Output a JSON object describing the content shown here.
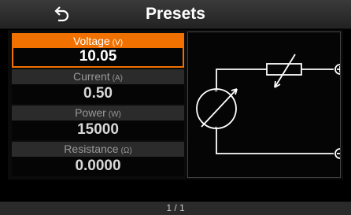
{
  "header": {
    "title": "Presets",
    "back_icon": "back-arrow-icon"
  },
  "parameters": [
    {
      "name": "Voltage",
      "unit": "(V)",
      "value": "10.05",
      "selected": true
    },
    {
      "name": "Current",
      "unit": "(A)",
      "value": "0.50",
      "selected": false
    },
    {
      "name": "Power",
      "unit": "(W)",
      "value": "15000",
      "selected": false
    },
    {
      "name": "Resistance",
      "unit": "(Ω)",
      "value": "0.0000",
      "selected": false
    }
  ],
  "diagram": {
    "plus_symbol": "⊕",
    "minus_symbol": "⊖"
  },
  "footer": {
    "page": "1 / 1"
  },
  "colors": {
    "accent": "#f07000",
    "background": "#000000"
  }
}
